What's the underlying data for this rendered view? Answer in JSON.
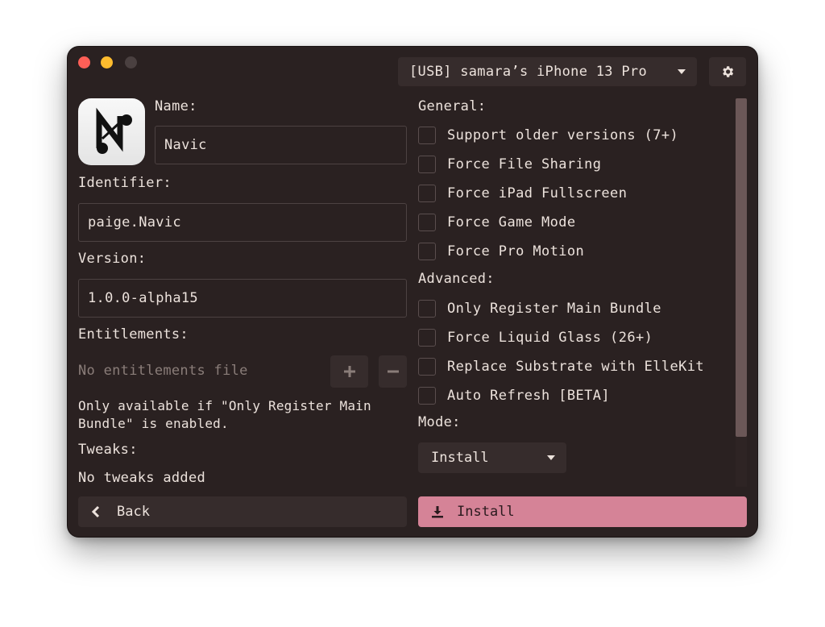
{
  "colors": {
    "window_bg": "#2a2121",
    "control_bg": "#362c2c",
    "accent": "#d58397",
    "text": "#ece2dc",
    "muted_text": "#8a7d79",
    "close": "#fe5f57",
    "minimize": "#febc2e"
  },
  "header": {
    "device": "[USB] samara’s iPhone 13 Pro",
    "device_icon": "chevron-down-icon",
    "settings_icon": "gear-icon"
  },
  "app": {
    "icon": "navic-app-icon",
    "name_label": "Name:",
    "name_value": "Navic",
    "identifier_label": "Identifier:",
    "identifier_value": "paige.Navic",
    "version_label": "Version:",
    "version_value": "1.0.0-alpha15",
    "entitlements_label": "Entitlements:",
    "entitlements_value": "No entitlements file",
    "entitlements_note": "Only available if \"Only Register Main Bundle\" is enabled.",
    "tweaks_label": "Tweaks:",
    "tweaks_value": "No tweaks added"
  },
  "general": {
    "label": "General:",
    "options": [
      {
        "label": "Support older versions (7+)",
        "checked": false
      },
      {
        "label": "Force File Sharing",
        "checked": false
      },
      {
        "label": "Force iPad Fullscreen",
        "checked": false
      },
      {
        "label": "Force Game Mode",
        "checked": false
      },
      {
        "label": "Force Pro Motion",
        "checked": false
      }
    ]
  },
  "advanced": {
    "label": "Advanced:",
    "options": [
      {
        "label": "Only Register Main Bundle",
        "checked": false
      },
      {
        "label": "Force Liquid Glass (26+)",
        "checked": false
      },
      {
        "label": "Replace Substrate with ElleKit",
        "checked": false
      },
      {
        "label": "Auto Refresh [BETA]",
        "checked": false
      }
    ]
  },
  "mode": {
    "label": "Mode:",
    "value": "Install"
  },
  "footer": {
    "back_label": "Back",
    "install_label": "Install"
  }
}
